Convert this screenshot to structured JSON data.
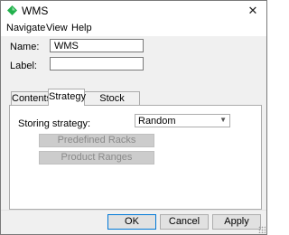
{
  "window": {
    "title": "WMS",
    "icon": "green-diamond-icon",
    "close_label": "✕"
  },
  "menu": {
    "items": [
      "Navigate",
      "View",
      "Help"
    ]
  },
  "form": {
    "name_label": "Name:",
    "name_value": "WMS",
    "label_label": "Label:",
    "label_value": ""
  },
  "tabs": [
    {
      "label": "Contents",
      "active": false
    },
    {
      "label": "Strategy",
      "active": true
    },
    {
      "label": "Stock Removal",
      "active": false
    }
  ],
  "strategy": {
    "storing_label": "Storing strategy:",
    "storing_value": "Random",
    "predefined_racks_label": "Predefined Racks",
    "product_ranges_label": "Product Ranges"
  },
  "footer": {
    "ok_label": "OK",
    "cancel_label": "Cancel",
    "apply_label": "Apply"
  },
  "colors": {
    "accent": "#0078d7",
    "icon_green": "#22b14c"
  }
}
